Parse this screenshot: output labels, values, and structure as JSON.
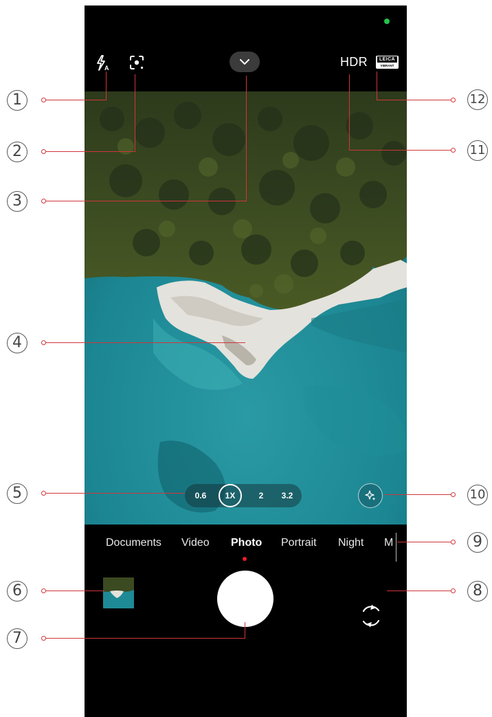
{
  "status": {
    "privacy_indicator_color": "#25c24d"
  },
  "top_bar": {
    "flash_icon": "flash-auto-icon",
    "focus_icon": "google-lens-icon",
    "more_icon": "chevron-down-icon",
    "hdr_label": "HDR",
    "leica_label": "LEICA",
    "leica_sub": "VIBRANT"
  },
  "zoom": {
    "levels": [
      "0.6",
      "1X",
      "2",
      "3.2"
    ],
    "selected": "1X"
  },
  "ai_icon": "ai-sparkle-icon",
  "modes": {
    "items": [
      "Documents",
      "Video",
      "Photo",
      "Portrait",
      "Night",
      "M"
    ],
    "active": "Photo",
    "active_indicator_color": "#e8202a"
  },
  "bottom": {
    "gallery_icon": "gallery-thumbnail",
    "shutter_icon": "shutter-button",
    "switch_icon": "switch-camera-icon"
  },
  "callouts": [
    "1",
    "2",
    "3",
    "4",
    "5",
    "6",
    "7",
    "8",
    "9",
    "10",
    "11",
    "12"
  ],
  "callout_line_color": "#d0363a"
}
